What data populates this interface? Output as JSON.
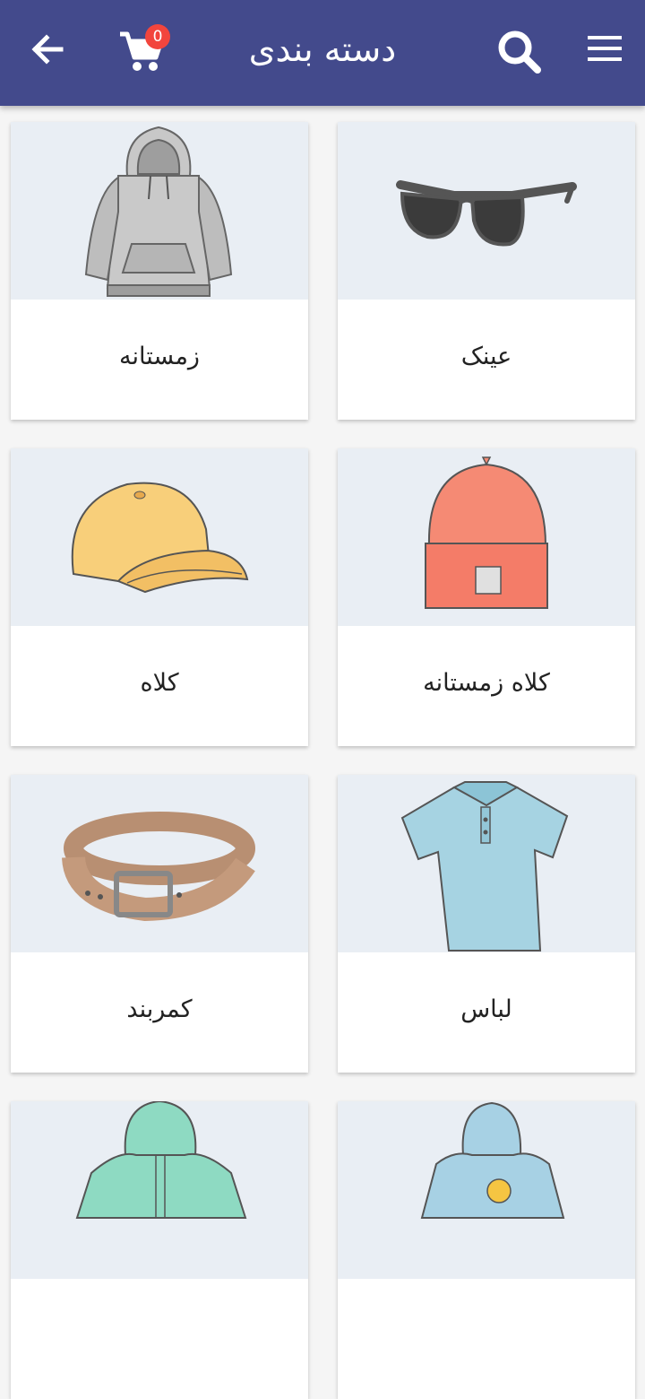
{
  "header": {
    "title": "دسته بندی",
    "cart_count": "0",
    "back_icon": "arrow-left-icon",
    "cart_icon": "cart-icon",
    "search_icon": "search-icon",
    "menu_icon": "menu-icon",
    "background": "#434a8c",
    "badge_color": "#f2453d"
  },
  "categories": [
    {
      "label": "عینک"
    },
    {
      "label": "زمستانه"
    },
    {
      "label": "کلاه زمستانه"
    },
    {
      "label": "کلاه"
    },
    {
      "label": "لباس"
    },
    {
      "label": "کمربند"
    },
    {
      "label": ""
    },
    {
      "label": ""
    }
  ]
}
